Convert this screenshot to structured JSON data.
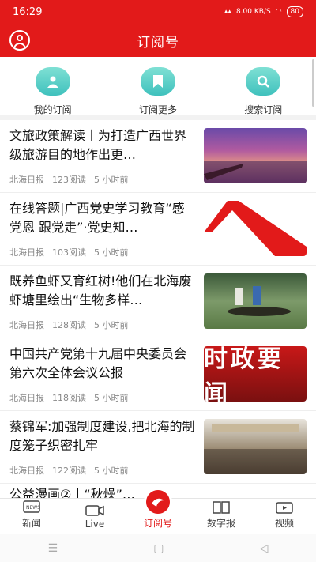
{
  "status": {
    "time": "16:29",
    "speed": "8.00",
    "speed_unit": "KB/S",
    "battery": "80"
  },
  "header": {
    "title": "订阅号"
  },
  "quick": [
    {
      "label": "我的订阅",
      "icon": "user-icon"
    },
    {
      "label": "订阅更多",
      "icon": "bookmark-icon"
    },
    {
      "label": "搜索订阅",
      "icon": "search-icon"
    }
  ],
  "articles": [
    {
      "title": "文旅政策解读丨为打造广西世界级旅游目的地作出更…",
      "source": "北海日报",
      "reads": "123阅读",
      "time": "5 小时前"
    },
    {
      "title": "在线答题|广西党史学习教育“感党恩 跟党走”·党史知…",
      "source": "北海日报",
      "reads": "103阅读",
      "time": "5 小时前"
    },
    {
      "title": "既养鱼虾又育红树!他们在北海废虾塘里绘出“生物多样…",
      "source": "北海日报",
      "reads": "128阅读",
      "time": "5 小时前"
    },
    {
      "title": "中国共产党第十九届中央委员会第六次全体会议公报",
      "source": "北海日报",
      "reads": "118阅读",
      "time": "5 小时前",
      "thumb_text": "时政要闻"
    },
    {
      "title": "蔡锦军:加强制度建设,把北海的制度笼子织密扎牢",
      "source": "北海日报",
      "reads": "122阅读",
      "time": "5 小时前"
    }
  ],
  "partial_title": "公益漫画②丨“秋燥”…",
  "tabs": [
    {
      "label": "新闻",
      "icon": "news-icon"
    },
    {
      "label": "Live",
      "icon": "camera-icon"
    },
    {
      "label": "订阅号",
      "icon": "subscription-icon"
    },
    {
      "label": "数字报",
      "icon": "book-icon"
    },
    {
      "label": "视频",
      "icon": "tv-icon"
    }
  ],
  "colors": {
    "brand": "#e21a1a",
    "teal": "#3fc1bd"
  }
}
